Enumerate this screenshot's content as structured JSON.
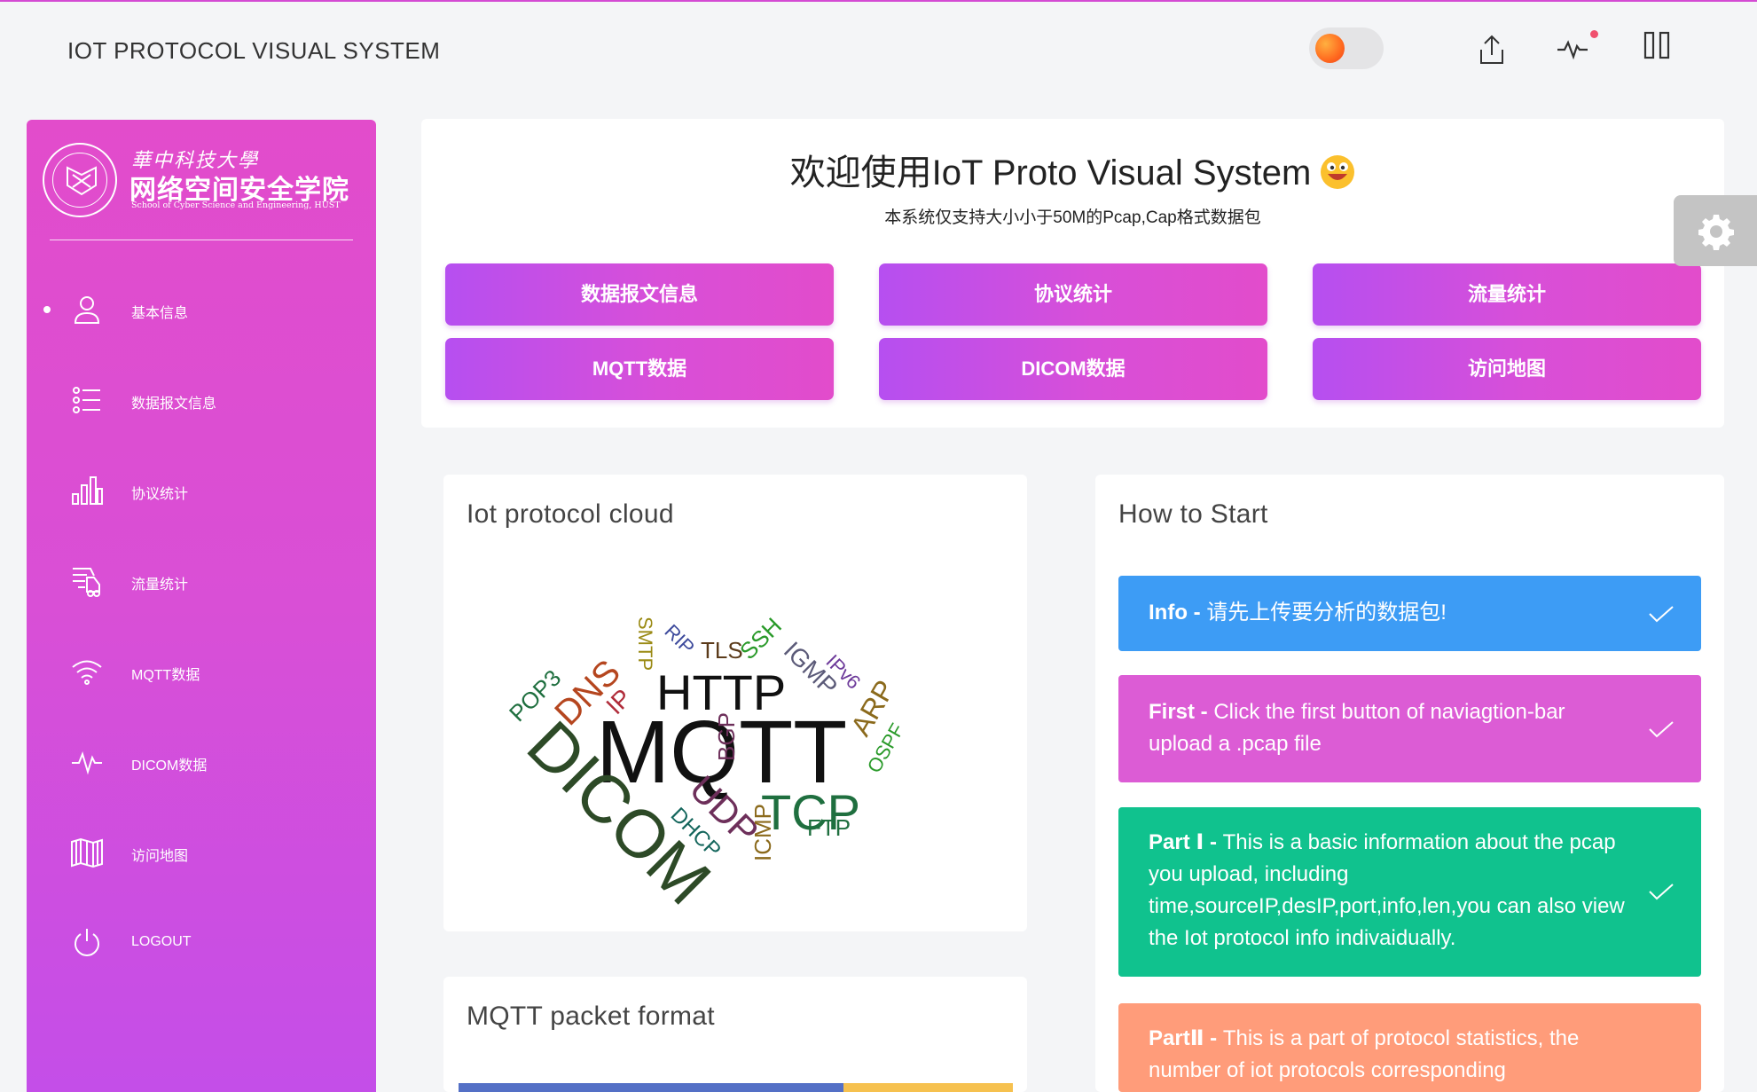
{
  "app": {
    "title": "IOT PROTOCOL VISUAL SYSTEM"
  },
  "topbar": {
    "icons": [
      "upload-icon",
      "activity-icon",
      "pause-icon"
    ],
    "toggle_color": "#ff6a1f"
  },
  "sidebar": {
    "logo": {
      "line1": "華中科技大學",
      "line2": "网络空间安全学院",
      "line3": "School of Cyber Science and Engineering, HUST"
    },
    "items": [
      {
        "label": "基本信息",
        "icon": "user-icon",
        "active": true
      },
      {
        "label": "数据报文信息",
        "icon": "list-icon"
      },
      {
        "label": "协议统计",
        "icon": "bar-chart-icon"
      },
      {
        "label": "流量统计",
        "icon": "traffic-icon"
      },
      {
        "label": "MQTT数据",
        "icon": "wifi-icon"
      },
      {
        "label": "DICOM数据",
        "icon": "pulse-icon"
      },
      {
        "label": "访问地图",
        "icon": "map-icon"
      },
      {
        "label": "LOGOUT",
        "icon": "power-icon"
      }
    ]
  },
  "welcome": {
    "title": "欢迎使用IoT Proto Visual System",
    "subtitle": "本系统仅支持大小小于50M的Pcap,Cap格式数据包",
    "buttons": [
      "数据报文信息",
      "协议统计",
      "流量统计",
      "MQTT数据",
      "DICOM数据",
      "访问地图"
    ]
  },
  "cloud": {
    "title": "Iot protocol cloud",
    "words": [
      "MQTT",
      "DICOM",
      "HTTP",
      "TCP",
      "UDP",
      "DNS",
      "BGP",
      "ICMP",
      "DHCP",
      "FTP",
      "POP3",
      "IP",
      "SMTP",
      "RIP",
      "TLS",
      "SSH",
      "IGMP",
      "IPv6",
      "ARP",
      "OSPF"
    ]
  },
  "mqtt_card": {
    "title": "MQTT packet format"
  },
  "howto": {
    "title": "How to Start",
    "steps": [
      {
        "lead": "Info - ",
        "text": "请先上传要分析的数据包!",
        "color": "#3d9cf5"
      },
      {
        "lead": "First - ",
        "text": "Click the first button of naviagtion-bar upload a .pcap file",
        "color": "#dc5cd5"
      },
      {
        "lead": "Part Ⅰ - ",
        "text": "This is a basic information about the pcap you upload, including time,sourceIP,desIP,port,info,len,you can also view the Iot protocol info indivaidually.",
        "color": "#10c28e"
      },
      {
        "lead": "PartⅡ - ",
        "text": "This is a part of protocol statistics, the number of iot protocols corresponding",
        "color": "#ff9c7a"
      }
    ]
  }
}
